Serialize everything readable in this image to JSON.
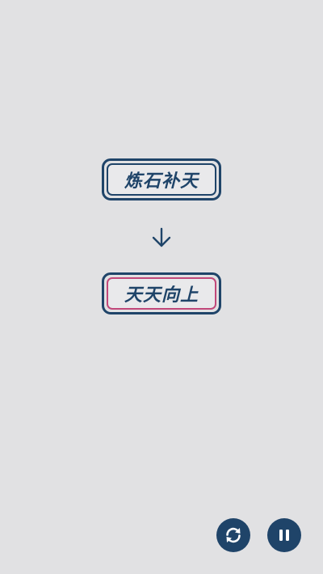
{
  "puzzle": {
    "source_word": "炼石补天",
    "target_word": "天天向上"
  },
  "icons": {
    "arrow": "arrow-down-icon",
    "restart": "restart-icon",
    "pause": "pause-icon"
  },
  "colors": {
    "background": "#e1e1e3",
    "primary": "#1f4469",
    "accent": "#c1487a"
  }
}
